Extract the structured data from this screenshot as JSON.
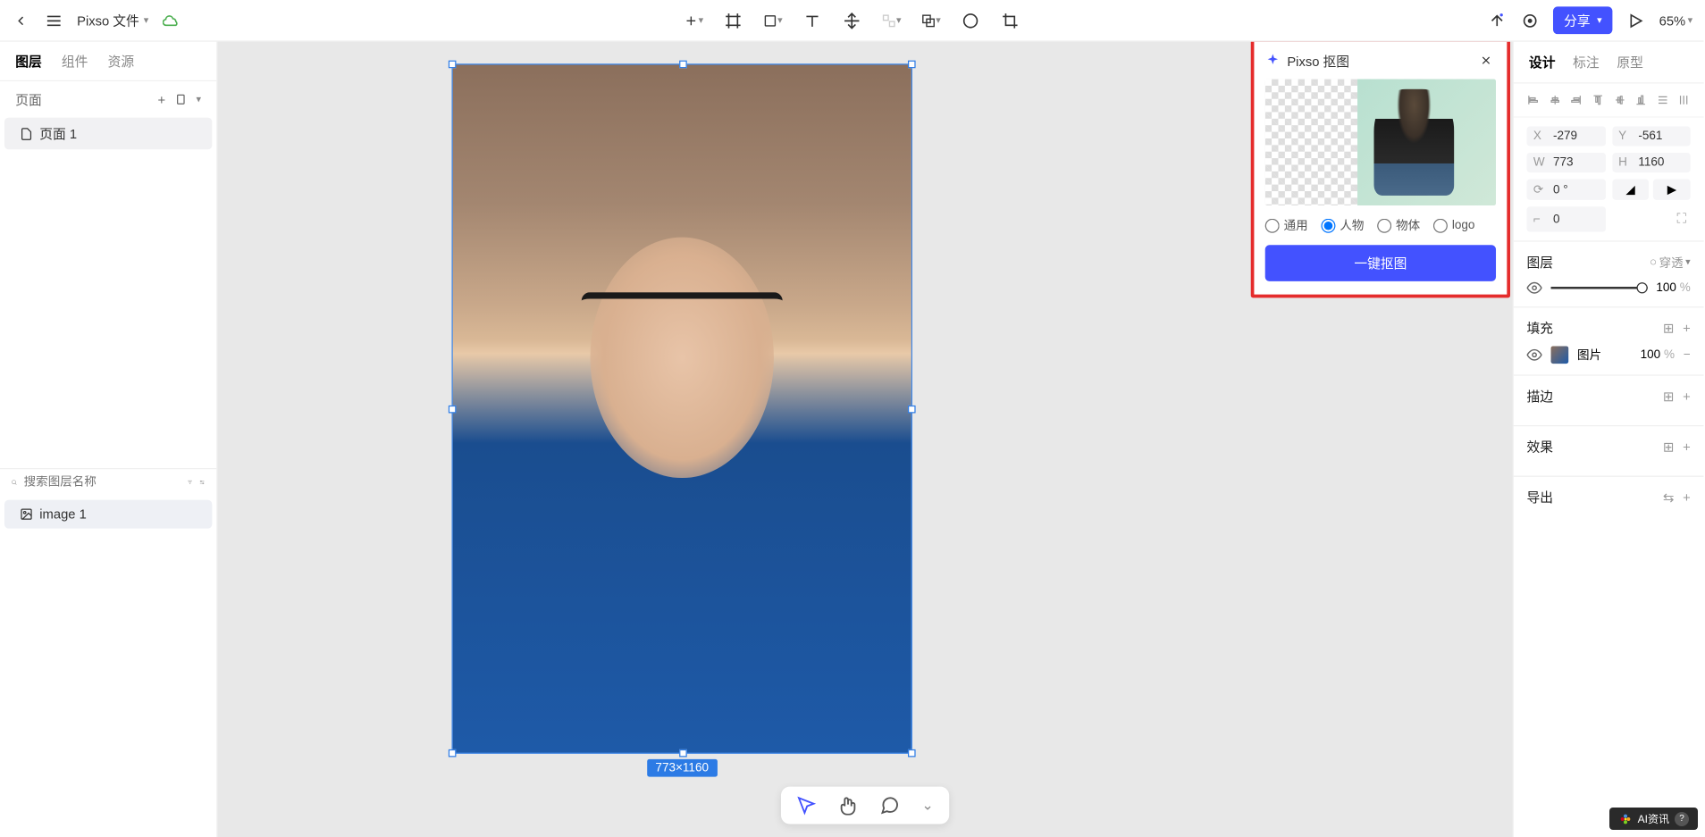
{
  "topbar": {
    "file_name": "Pixso 文件",
    "zoom": "65%"
  },
  "share_button": "分享",
  "left_panel": {
    "tabs": {
      "layers": "图层",
      "components": "组件",
      "assets": "资源"
    },
    "pages_label": "页面",
    "pages": [
      {
        "name": "页面 1"
      }
    ],
    "search_placeholder": "搜索图层名称",
    "layers": [
      {
        "name": "image 1"
      }
    ]
  },
  "canvas": {
    "dimension_badge": "773×1160"
  },
  "cutout": {
    "title": "Pixso 抠图",
    "options": {
      "general": "通用",
      "person": "人物",
      "object": "物体",
      "logo": "logo"
    },
    "button": "一键抠图"
  },
  "bottom_tools": {
    "cursor": "cursor",
    "hand": "hand",
    "comment": "comment",
    "more": "more"
  },
  "right_panel": {
    "tabs": {
      "design": "设计",
      "annotate": "标注",
      "prototype": "原型"
    },
    "position": {
      "x_label": "X",
      "x_value": "-279",
      "y_label": "Y",
      "y_value": "-561"
    },
    "size": {
      "w_label": "W",
      "w_value": "773",
      "h_label": "H",
      "h_value": "1160"
    },
    "rotation": {
      "label": "⟳",
      "value": "0 °"
    },
    "corner": {
      "label": "⌐",
      "value": "0"
    },
    "layer_section": {
      "title": "图层",
      "blend": "穿透",
      "opacity_value": "100",
      "opacity_unit": "%"
    },
    "fill_section": {
      "title": "填充",
      "type": "图片",
      "opacity": "100",
      "unit": "%"
    },
    "stroke_section": {
      "title": "描边"
    },
    "effects_section": {
      "title": "效果"
    },
    "export_section": {
      "title": "导出"
    }
  },
  "watermark": "AI资讯"
}
